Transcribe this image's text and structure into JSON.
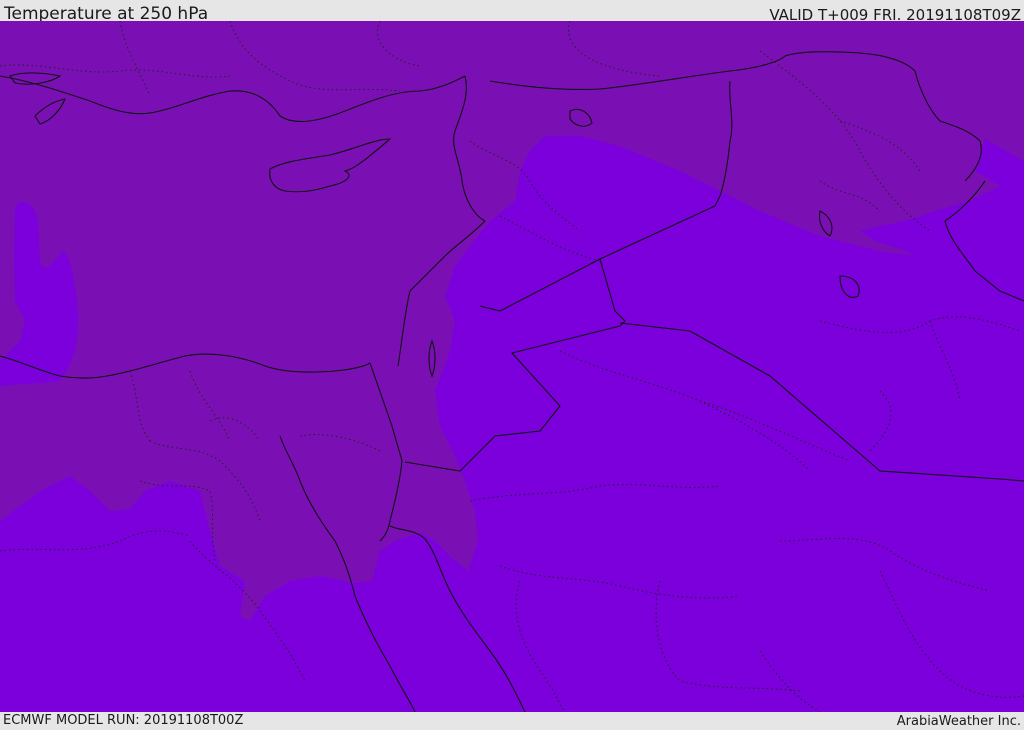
{
  "header": {
    "title": "Temperature at 250 hPa",
    "valid": "VALID T+009 FRI. 20191108T09Z"
  },
  "footer": {
    "model_run": "ECMWF MODEL RUN: 20191108T00Z",
    "credit": "ArabiaWeather Inc."
  },
  "map": {
    "colors": {
      "warm_band": "#7a10b4",
      "cold_band": "#7b00dc",
      "coastline": "#111111",
      "border": "#222222"
    }
  }
}
